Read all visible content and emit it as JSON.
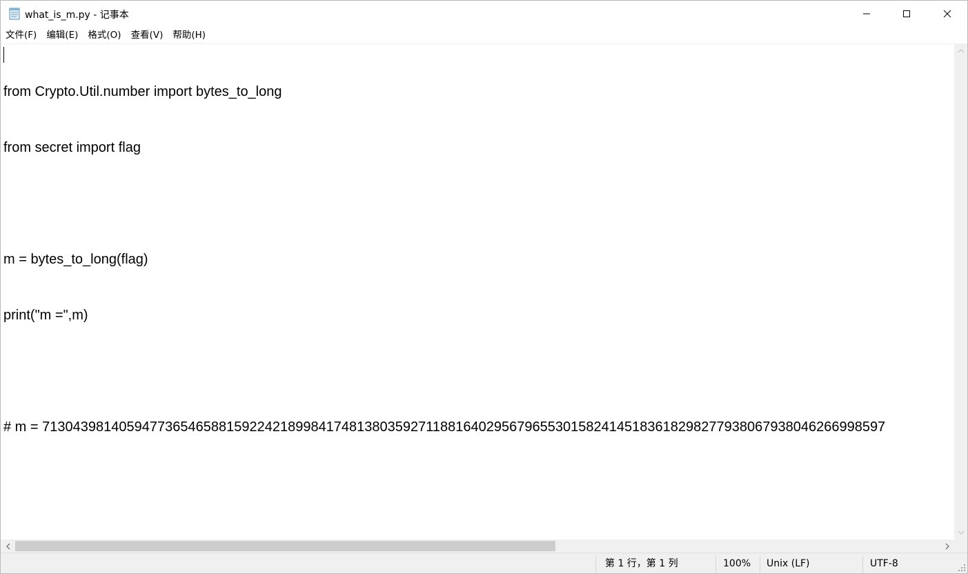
{
  "window": {
    "title": "what_is_m.py - 记事本",
    "icon": "notepad-icon",
    "controls": {
      "minimize_icon": "minimize-icon",
      "maximize_icon": "maximize-icon",
      "close_icon": "close-icon"
    }
  },
  "menu": {
    "items": [
      {
        "label": "文件(F)"
      },
      {
        "label": "编辑(E)"
      },
      {
        "label": "格式(O)"
      },
      {
        "label": "查看(V)"
      },
      {
        "label": "帮助(H)"
      }
    ]
  },
  "editor": {
    "lines": [
      "from Crypto.Util.number import bytes_to_long",
      "from secret import flag",
      "",
      "m = bytes_to_long(flag)",
      "print(\"m =\",m)",
      "",
      "# m = 71304398140594773654658815922421899841748138035927118816402956796553015824145183618298277938067938046266998597"
    ]
  },
  "statusbar": {
    "position": "第 1 行，第 1 列",
    "zoom": "100%",
    "line_ending": "Unix (LF)",
    "encoding": "UTF-8"
  },
  "colors": {
    "chrome_bg": "#f0f0f0",
    "scroll_thumb": "#cdcdcd",
    "text": "#000000"
  }
}
